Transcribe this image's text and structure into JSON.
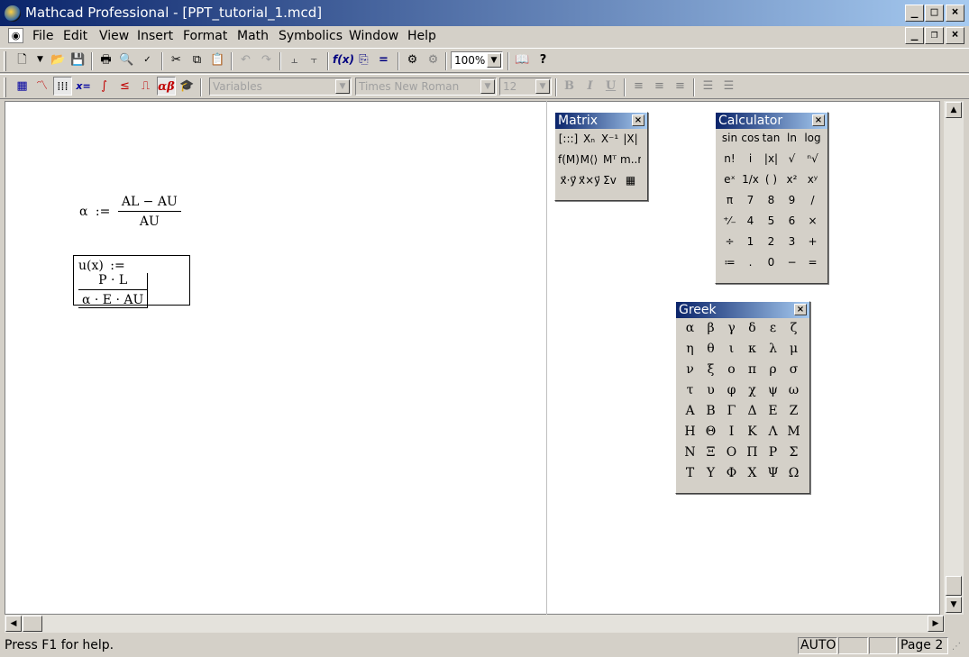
{
  "window": {
    "title": "Mathcad Professional - [PPT_tutorial_1.mcd]"
  },
  "menu": [
    "File",
    "Edit",
    "View",
    "Insert",
    "Format",
    "Math",
    "Symbolics",
    "Window",
    "Help"
  ],
  "standard_toolbar": {
    "zoom": "100%"
  },
  "formatting_toolbar": {
    "style": "Variables",
    "font": "Times New Roman",
    "size": "12",
    "bold": "B",
    "italic": "I",
    "underline": "U"
  },
  "math_toolbar_icons": [
    "calculator-icon",
    "graph-icon",
    "matrix-icon",
    "evaluation-icon",
    "calculus-icon",
    "boolean-icon",
    "programming-icon",
    "greek-icon",
    "symbolic-icon"
  ],
  "worksheet": {
    "eq1": {
      "lhs": "α",
      "op": ":=",
      "num": "AL − AU",
      "den": "AU"
    },
    "eq2": {
      "lhs": "u(x)",
      "op": ":=",
      "num": "P · L",
      "den": "α · E · AU"
    }
  },
  "matrix_palette": {
    "title": "Matrix",
    "buttons": [
      "[:::]",
      "Xₙ",
      "X⁻¹",
      "|X|",
      "f(M)",
      "M⟨⟩",
      "Mᵀ",
      "m..n",
      "x⃗·y⃗",
      "x⃗×y⃗",
      "Σv",
      "▦"
    ]
  },
  "calculator_palette": {
    "title": "Calculator",
    "buttons": [
      "sin",
      "cos",
      "tan",
      "ln",
      "log",
      "n!",
      "i",
      "|x|",
      "√",
      "ⁿ√",
      "eˣ",
      "1/x",
      "( )",
      "x²",
      "xʸ",
      "π",
      "7",
      "8",
      "9",
      "/",
      "⁺⁄₋",
      "4",
      "5",
      "6",
      "×",
      "÷",
      "1",
      "2",
      "3",
      "+",
      "≔",
      ".",
      "0",
      "−",
      "="
    ]
  },
  "greek_palette": {
    "title": "Greek",
    "letters": [
      "α",
      "β",
      "γ",
      "δ",
      "ε",
      "ζ",
      "η",
      "θ",
      "ι",
      "κ",
      "λ",
      "μ",
      "ν",
      "ξ",
      "ο",
      "π",
      "ρ",
      "σ",
      "τ",
      "υ",
      "φ",
      "χ",
      "ψ",
      "ω",
      "Α",
      "Β",
      "Γ",
      "Δ",
      "Ε",
      "Ζ",
      "Η",
      "Θ",
      "Ι",
      "Κ",
      "Λ",
      "Μ",
      "Ν",
      "Ξ",
      "Ο",
      "Π",
      "Ρ",
      "Σ",
      "Τ",
      "Υ",
      "Φ",
      "Χ",
      "Ψ",
      "Ω"
    ]
  },
  "status": {
    "help": "Press F1 for help.",
    "mode": "AUTO",
    "page": "Page 2"
  }
}
